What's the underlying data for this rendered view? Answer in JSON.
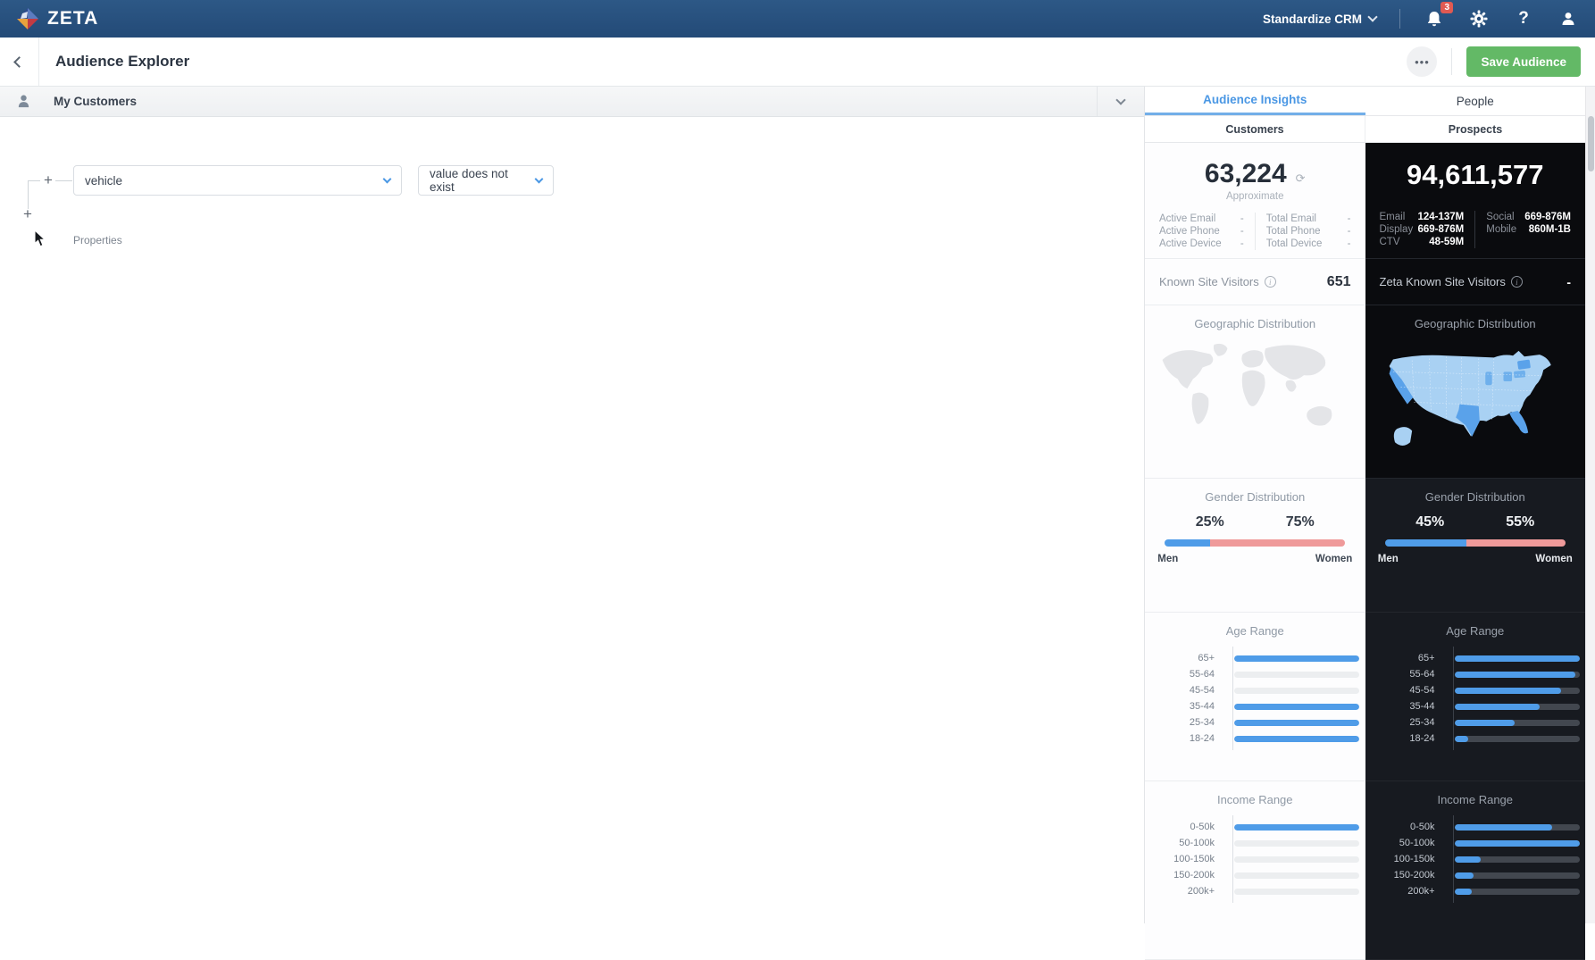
{
  "navbar": {
    "brand": "ZETA",
    "workspace": "Standardize CRM",
    "notification_count": "3"
  },
  "header": {
    "title": "Audience Explorer",
    "more_label": "•••",
    "save_label": "Save Audience"
  },
  "builder": {
    "segment_title": "My Customers",
    "properties_label": "Properties",
    "property_value": "vehicle",
    "operator_value": "value does not exist",
    "add_label": "+"
  },
  "insights": {
    "tabs": {
      "audience_insights": "Audience Insights",
      "people": "People"
    },
    "subtabs": {
      "customers": "Customers",
      "prospects": "Prospects"
    },
    "customers": {
      "count": "63,224",
      "count_caption": "Approximate",
      "refresh_icon": "⟳",
      "stats_left": [
        {
          "label": "Active Email",
          "value": "-"
        },
        {
          "label": "Active Phone",
          "value": "-"
        },
        {
          "label": "Active Device",
          "value": "-"
        }
      ],
      "stats_right": [
        {
          "label": "Total Email",
          "value": "-"
        },
        {
          "label": "Total Phone",
          "value": "-"
        },
        {
          "label": "Total Device",
          "value": "-"
        }
      ],
      "visitors": {
        "label": "Known Site Visitors",
        "value": "651"
      },
      "geo_title": "Geographic Distribution",
      "gender": {
        "title": "Gender Distribution",
        "men_display": "25%",
        "women_display": "75%",
        "men_pct": 25,
        "men_label": "Men",
        "women_label": "Women"
      },
      "age": {
        "title": "Age Range",
        "rows": [
          {
            "label": "65+",
            "pct": 100
          },
          {
            "label": "55-64",
            "pct": 0
          },
          {
            "label": "45-54",
            "pct": 0
          },
          {
            "label": "35-44",
            "pct": 100
          },
          {
            "label": "25-34",
            "pct": 100
          },
          {
            "label": "18-24",
            "pct": 100
          }
        ]
      },
      "income": {
        "title": "Income Range",
        "rows": [
          {
            "label": "0-50k",
            "pct": 100
          },
          {
            "label": "50-100k",
            "pct": 0
          },
          {
            "label": "100-150k",
            "pct": 0
          },
          {
            "label": "150-200k",
            "pct": 0
          },
          {
            "label": "200k+",
            "pct": 0
          }
        ]
      }
    },
    "prospects": {
      "count": "94,611,577",
      "stats_left": [
        {
          "label": "Email",
          "value": "124-137M"
        },
        {
          "label": "Display",
          "value": "669-876M"
        },
        {
          "label": "CTV",
          "value": "48-59M"
        }
      ],
      "stats_right": [
        {
          "label": "Social",
          "value": "669-876M"
        },
        {
          "label": "Mobile",
          "value": "860M-1B"
        }
      ],
      "visitors": {
        "label": "Zeta Known Site Visitors",
        "value": "-"
      },
      "geo_title": "Geographic Distribution",
      "gender": {
        "title": "Gender Distribution",
        "men_display": "45%",
        "women_display": "55%",
        "men_pct": 45,
        "men_label": "Men",
        "women_label": "Women"
      },
      "age": {
        "title": "Age Range",
        "rows": [
          {
            "label": "65+",
            "pct": 100
          },
          {
            "label": "55-64",
            "pct": 97
          },
          {
            "label": "45-54",
            "pct": 85
          },
          {
            "label": "35-44",
            "pct": 68
          },
          {
            "label": "25-34",
            "pct": 48
          },
          {
            "label": "18-24",
            "pct": 11
          }
        ]
      },
      "income": {
        "title": "Income Range",
        "rows": [
          {
            "label": "0-50k",
            "pct": 78
          },
          {
            "label": "50-100k",
            "pct": 100
          },
          {
            "label": "100-150k",
            "pct": 21
          },
          {
            "label": "150-200k",
            "pct": 15
          },
          {
            "label": "200k+",
            "pct": 14
          }
        ]
      }
    }
  },
  "colors": {
    "accent_blue": "#4a97e4",
    "bar_blue": "#4f9ce8",
    "gender_pink": "#ef9a9a",
    "save_green": "#63b966",
    "navbar_blue": "#234a77",
    "badge_red": "#e05a52"
  }
}
